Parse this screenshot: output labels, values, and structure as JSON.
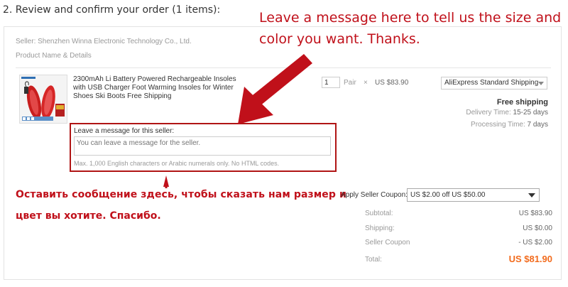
{
  "heading": "2. Review and confirm your order (1 items):",
  "seller": "Seller: Shenzhen Winna Electronic Technology Co., Ltd.",
  "product_header": "Product Name & Details",
  "product": {
    "title": "2300mAh Li Battery Powered Rechargeable Insoles with USB Charger Foot Warming Insoles for Winter Shoes Ski Boots Free Shipping",
    "image_icon": "heated-insoles-product-image"
  },
  "quantity": {
    "value": "1",
    "unit": "Pair",
    "times": "×",
    "price": "US $83.90"
  },
  "shipping": {
    "method": "AliExpress Standard Shipping",
    "free": "Free shipping",
    "delivery_label": "Delivery Time:",
    "delivery_value": "15-25 days",
    "processing_label": "Processing Time:",
    "processing_value": "7 days"
  },
  "message": {
    "label": "Leave a message for this seller:",
    "placeholder": "You can leave a message for the seller.",
    "hint": "Max. 1,000 English characters or Arabic numerals only. No HTML codes."
  },
  "annotations": {
    "english": "Leave a message here to tell us the size and color you want. Thanks.",
    "russian_line1": "Оставить сообщение здесь, чтобы сказать нам размер и",
    "russian_line2": "цвет вы хотите. Спасибо."
  },
  "coupon": {
    "label": "Apply Seller Coupon:",
    "selected": "US $2.00 off US $50.00"
  },
  "summary": {
    "subtotal_label": "Subtotal:",
    "subtotal_value": "US $83.90",
    "shipping_label": "Shipping:",
    "shipping_value": "US $0.00",
    "coupon_label": "Seller Coupon",
    "coupon_value": "- US $2.00",
    "total_label": "Total:",
    "total_value": "US $81.90"
  },
  "colors": {
    "annotation_red": "#c0101a",
    "total_orange": "#f26b1d"
  }
}
